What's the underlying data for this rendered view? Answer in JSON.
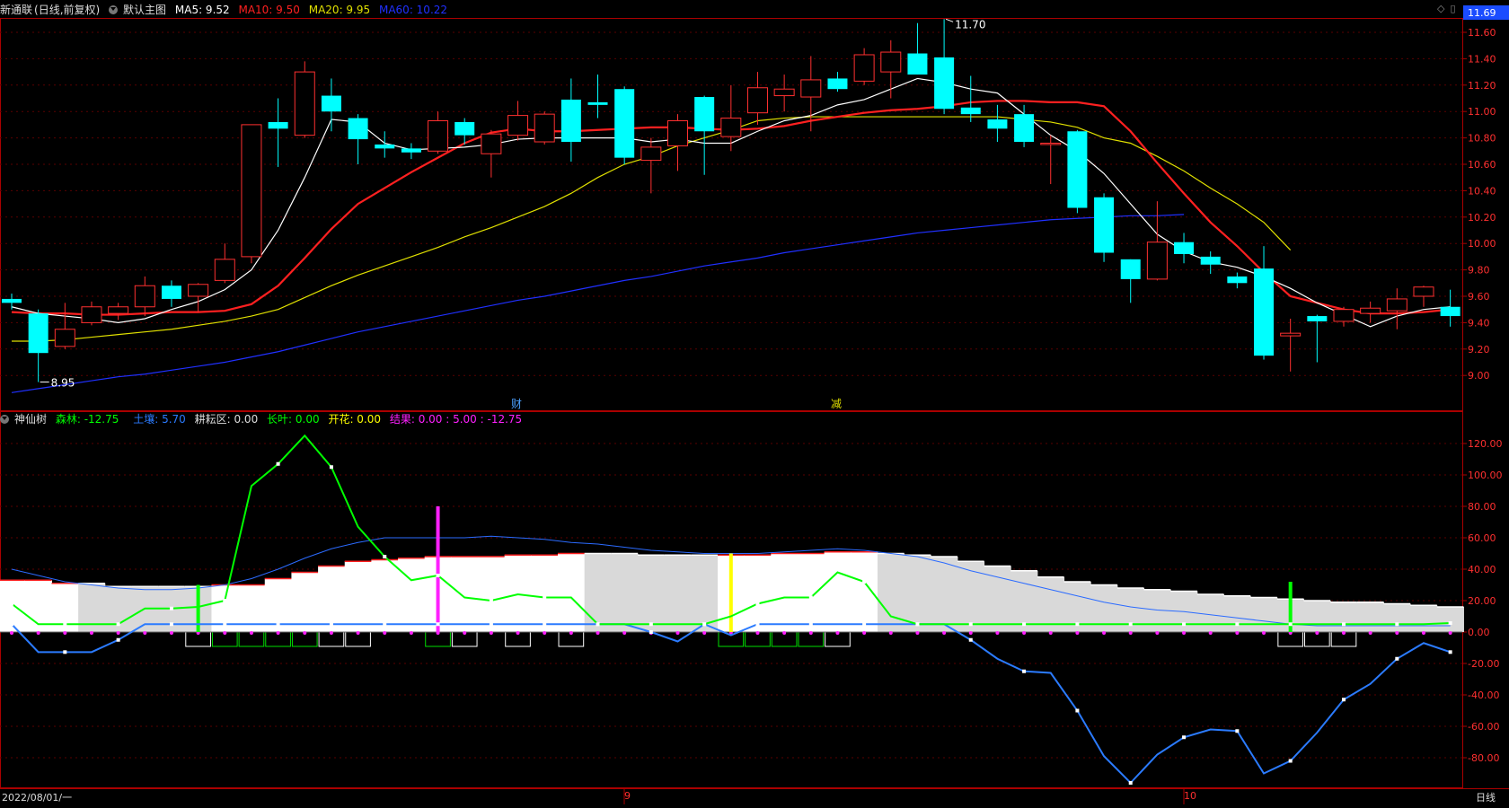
{
  "header": {
    "stock_name": "新通联",
    "period": "(日线,前复权)",
    "main_label": "默认主图",
    "ma5": "MA5: 9.52",
    "ma10": "MA10: 9.50",
    "ma20": "MA20: 9.95",
    "ma60": "MA60: 10.22",
    "right_price": "11.69",
    "colors": {
      "ma5": "#ffffff",
      "ma10": "#ff2020",
      "ma20": "#e0e000",
      "ma60": "#2030ff",
      "up": "#ff3030",
      "down": "#00ffff"
    }
  },
  "indicator_header": {
    "name": "神仙树",
    "forest": "森林: -12.75",
    "soil": "土壤: 5.70",
    "farm": "耕耘区: 0.00",
    "leaf": "长叶: 0.00",
    "bloom": "开花: 0.00",
    "fruit": "结果: 0.00 : 5.00 : -12.75"
  },
  "footer": {
    "date_start": "2022/08/01/一",
    "month_9": "9",
    "month_10": "10",
    "period_label": "日线"
  },
  "annotations": {
    "high_label": "11.70",
    "low_label": "8.95",
    "event_cai": "财",
    "event_jian": "减"
  },
  "chart_data": [
    {
      "type": "candlestick",
      "title": "新通联 (日线,前复权)",
      "y_ticks": [
        "11.60",
        "11.40",
        "11.20",
        "11.00",
        "10.80",
        "10.60",
        "10.40",
        "10.20",
        "10.00",
        "9.80",
        "9.60",
        "9.40",
        "9.20",
        "9.00"
      ],
      "ylim": [
        8.86,
        11.84
      ],
      "candles": [
        [
          9.58,
          9.55,
          9.62,
          9.5
        ],
        [
          9.47,
          9.17,
          9.5,
          8.95
        ],
        [
          9.22,
          9.35,
          9.55,
          9.2
        ],
        [
          9.4,
          9.52,
          9.56,
          9.38
        ],
        [
          9.47,
          9.52,
          9.55,
          9.42
        ],
        [
          9.52,
          9.68,
          9.75,
          9.45
        ],
        [
          9.68,
          9.58,
          9.72,
          9.52
        ],
        [
          9.6,
          9.69,
          9.7,
          9.48
        ],
        [
          9.72,
          9.88,
          10.0,
          9.7
        ],
        [
          9.9,
          10.9,
          10.9,
          9.85
        ],
        [
          10.92,
          10.87,
          11.1,
          10.58
        ],
        [
          10.82,
          11.3,
          11.38,
          10.8
        ],
        [
          11.12,
          11.0,
          11.25,
          10.85
        ],
        [
          10.95,
          10.79,
          10.98,
          10.6
        ],
        [
          10.75,
          10.72,
          10.85,
          10.65
        ],
        [
          10.72,
          10.69,
          10.76,
          10.64
        ],
        [
          10.7,
          10.93,
          11.0,
          10.68
        ],
        [
          10.92,
          10.82,
          10.95,
          10.75
        ],
        [
          10.68,
          10.83,
          10.86,
          10.5
        ],
        [
          10.82,
          10.97,
          11.08,
          10.78
        ],
        [
          10.77,
          10.98,
          11.0,
          10.75
        ],
        [
          11.09,
          10.77,
          11.25,
          10.62
        ],
        [
          11.07,
          11.05,
          11.28,
          10.95
        ],
        [
          11.17,
          10.65,
          11.19,
          10.6
        ],
        [
          10.63,
          10.73,
          10.8,
          10.38
        ],
        [
          10.74,
          10.93,
          10.98,
          10.55
        ],
        [
          11.11,
          10.85,
          11.12,
          10.52
        ],
        [
          10.81,
          10.95,
          11.2,
          10.7
        ],
        [
          10.99,
          11.18,
          11.3,
          10.9
        ],
        [
          11.12,
          11.17,
          11.28,
          11.0
        ],
        [
          11.11,
          11.24,
          11.42,
          10.85
        ],
        [
          11.25,
          11.17,
          11.3,
          11.15
        ],
        [
          11.23,
          11.43,
          11.48,
          11.2
        ],
        [
          11.3,
          11.45,
          11.54,
          11.1
        ],
        [
          11.44,
          11.28,
          11.67,
          11.28
        ],
        [
          11.41,
          11.02,
          11.7,
          10.98
        ],
        [
          11.03,
          10.98,
          11.27,
          10.92
        ],
        [
          10.94,
          10.87,
          11.05,
          10.77
        ],
        [
          10.98,
          10.77,
          11.05,
          10.73
        ],
        [
          10.76,
          10.76,
          10.82,
          10.45
        ],
        [
          10.85,
          10.27,
          10.86,
          10.23
        ],
        [
          10.35,
          9.93,
          10.38,
          9.86
        ],
        [
          9.88,
          9.73,
          9.88,
          9.55
        ],
        [
          9.73,
          10.01,
          10.32,
          9.72
        ],
        [
          10.01,
          9.92,
          10.08,
          9.85
        ],
        [
          9.9,
          9.84,
          9.94,
          9.77
        ],
        [
          9.75,
          9.7,
          9.78,
          9.66
        ],
        [
          9.81,
          9.15,
          9.98,
          9.12
        ],
        [
          9.3,
          9.32,
          9.43,
          9.03
        ],
        [
          9.45,
          9.41,
          9.46,
          9.1
        ],
        [
          9.41,
          9.5,
          9.52,
          9.37
        ],
        [
          9.47,
          9.51,
          9.56,
          9.4
        ],
        [
          9.49,
          9.58,
          9.66,
          9.35
        ],
        [
          9.6,
          9.67,
          9.68,
          9.52
        ],
        [
          9.52,
          9.45,
          9.65,
          9.37
        ]
      ],
      "ma5": [
        9.52,
        9.47,
        9.45,
        9.43,
        9.4,
        9.43,
        9.5,
        9.56,
        9.65,
        9.8,
        10.1,
        10.5,
        10.94,
        10.92,
        10.76,
        10.71,
        10.72,
        10.73,
        10.75,
        10.79,
        10.8,
        10.8,
        10.8,
        10.8,
        10.77,
        10.79,
        10.76,
        10.76,
        10.85,
        10.93,
        10.97,
        11.05,
        11.09,
        11.17,
        11.25,
        11.22,
        11.17,
        11.14,
        10.98,
        10.82,
        10.7,
        10.53,
        10.3,
        10.07,
        9.94,
        9.86,
        9.82,
        9.75,
        9.66,
        9.55,
        9.46,
        9.37,
        9.45,
        9.5,
        9.52
      ],
      "ma10": [
        9.48,
        9.47,
        9.47,
        9.46,
        9.46,
        9.47,
        9.48,
        9.48,
        9.49,
        9.54,
        9.68,
        9.89,
        10.11,
        10.3,
        10.42,
        10.54,
        10.65,
        10.76,
        10.84,
        10.87,
        10.85,
        10.85,
        10.86,
        10.87,
        10.88,
        10.88,
        10.87,
        10.86,
        10.87,
        10.89,
        10.93,
        10.96,
        10.99,
        11.01,
        11.02,
        11.04,
        11.07,
        11.08,
        11.08,
        11.07,
        11.07,
        11.04,
        10.85,
        10.61,
        10.38,
        10.16,
        9.98,
        9.78,
        9.6,
        9.55,
        9.5,
        9.47,
        9.47,
        9.48,
        9.5
      ],
      "ma20": [
        9.26,
        9.26,
        9.27,
        9.29,
        9.31,
        9.33,
        9.35,
        9.38,
        9.41,
        9.45,
        9.5,
        9.59,
        9.68,
        9.76,
        9.83,
        9.9,
        9.97,
        10.05,
        10.12,
        10.2,
        10.28,
        10.38,
        10.5,
        10.6,
        10.66,
        10.74,
        10.8,
        10.86,
        10.93,
        10.95,
        10.96,
        10.96,
        10.96,
        10.96,
        10.96,
        10.96,
        10.96,
        10.96,
        10.94,
        10.92,
        10.88,
        10.8,
        10.76,
        10.66,
        10.55,
        10.42,
        10.3,
        10.16,
        9.95
      ],
      "ma60": [
        8.87,
        8.9,
        8.93,
        8.96,
        8.99,
        9.01,
        9.04,
        9.07,
        9.1,
        9.14,
        9.18,
        9.23,
        9.28,
        9.33,
        9.37,
        9.41,
        9.45,
        9.49,
        9.53,
        9.57,
        9.6,
        9.64,
        9.68,
        9.72,
        9.75,
        9.79,
        9.83,
        9.86,
        9.89,
        9.93,
        9.96,
        9.99,
        10.02,
        10.05,
        10.08,
        10.1,
        10.12,
        10.14,
        10.16,
        10.18,
        10.19,
        10.2,
        10.21,
        10.21,
        10.22
      ]
    },
    {
      "type": "line",
      "title": "神仙树",
      "y_ticks": [
        "120.00",
        "100.00",
        "80.00",
        "60.00",
        "40.00",
        "20.00",
        "0.00",
        "-20.00",
        "-40.00",
        "-60.00",
        "-80.00"
      ],
      "ylim": [
        -95,
        137
      ],
      "series": [
        {
          "name": "森林",
          "color": "#2b7bff",
          "values": [
            5,
            -12.75,
            -12.75,
            -12.75,
            -5,
            5,
            5,
            5,
            5,
            5,
            5,
            5,
            5,
            5,
            5,
            5,
            5,
            5,
            5,
            5,
            5,
            5,
            5,
            5,
            0,
            -6,
            5,
            -2,
            5,
            5,
            5,
            5,
            5,
            5,
            5,
            5,
            -5,
            -17,
            -25,
            -26,
            -50,
            -79,
            -96,
            -78,
            -67,
            -62,
            -63,
            -90,
            -82,
            -64,
            -43,
            -33,
            -17,
            -7,
            -12.75
          ]
        },
        {
          "name": "土壤",
          "color": "#00ff00",
          "values": [
            18,
            5,
            5,
            5,
            5,
            15,
            15,
            16,
            20,
            93,
            107,
            125,
            105,
            67,
            48,
            33,
            36,
            22,
            20,
            24,
            22,
            22,
            5,
            5,
            5,
            5,
            5,
            10,
            18,
            22,
            22,
            38,
            32,
            10,
            5,
            5,
            5,
            5,
            5,
            5,
            5,
            5,
            5,
            5,
            5,
            5,
            5,
            5,
            5,
            5,
            5,
            5,
            5,
            5,
            5.7
          ]
        }
      ],
      "soil_area": [
        33,
        33,
        31,
        31,
        29,
        29,
        29,
        29,
        30,
        30,
        34,
        38,
        42,
        45,
        46,
        47,
        48,
        48,
        48,
        49,
        49,
        50,
        50,
        50,
        49,
        49,
        49,
        49,
        49,
        50,
        50,
        51,
        51,
        50,
        49,
        48,
        45,
        42,
        39,
        35,
        32,
        30,
        28,
        27,
        26,
        24,
        23,
        22,
        21,
        20,
        19,
        19,
        18,
        17,
        16
      ],
      "soil_filled": [
        true,
        true,
        true,
        false,
        false,
        false,
        false,
        false,
        true,
        true,
        true,
        true,
        true,
        true,
        true,
        true,
        true,
        true,
        true,
        true,
        true,
        true,
        false,
        false,
        false,
        false,
        false,
        true,
        true,
        true,
        true,
        true,
        true,
        false,
        false,
        false,
        false,
        false,
        false,
        false,
        false,
        false,
        false,
        false,
        false,
        false,
        false,
        false,
        false,
        false,
        false,
        false,
        false,
        false,
        false
      ],
      "forest_line": [
        40,
        36,
        32,
        30,
        28,
        27,
        27,
        28,
        30,
        34,
        40,
        47,
        53,
        57,
        60,
        60,
        60,
        60,
        61,
        60,
        59,
        57,
        56,
        54,
        52,
        51,
        50,
        50,
        50,
        51,
        52,
        53,
        52,
        50,
        48,
        44,
        39,
        35,
        31,
        27,
        23,
        19,
        16,
        14,
        13,
        11,
        9,
        7,
        5,
        4,
        4,
        4,
        4,
        4,
        4
      ],
      "markers": [
        {
          "index": 7,
          "value": 30,
          "color": "#00ff00"
        },
        {
          "index": 16,
          "value": 80,
          "color": "#ff20ff"
        },
        {
          "index": 27,
          "value": 50,
          "color": "#ffff00"
        },
        {
          "index": 48,
          "value": 32,
          "color": "#00ff00"
        }
      ],
      "blocks": [
        0,
        0,
        0,
        0,
        0,
        0,
        0,
        1,
        2,
        2,
        2,
        2,
        1,
        1,
        0,
        0,
        2,
        1,
        0,
        1,
        0,
        1,
        0,
        0,
        0,
        0,
        0,
        2,
        2,
        2,
        2,
        1,
        0,
        0,
        0,
        0,
        0,
        0,
        0,
        0,
        0,
        0,
        0,
        0,
        0,
        0,
        0,
        0,
        1,
        1,
        1,
        0,
        0,
        0,
        0
      ]
    }
  ]
}
